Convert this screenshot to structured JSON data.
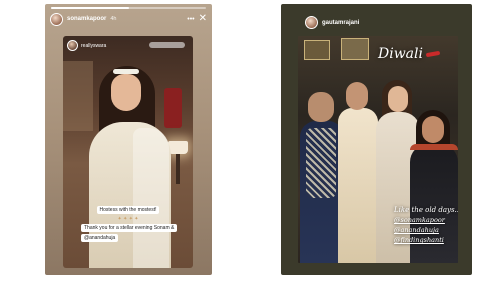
{
  "left_story": {
    "username": "sonamkapoor",
    "time": "4h",
    "progress": 0.5,
    "shared_post": {
      "username": "reallyswara"
    },
    "caption": {
      "line1": "Hostess with the mostest!",
      "line2": "Thank you for a stellar evening Sonam &",
      "line3": "@anandahuja"
    },
    "icons": [
      "more-icon",
      "close-icon"
    ]
  },
  "right_story": {
    "username": "gautamrajani",
    "title": "Diwali",
    "caption": {
      "line1": "Like the old days..",
      "tags": [
        "@sonamkapoor",
        "@anandahuja",
        "@findingshanti"
      ]
    }
  }
}
